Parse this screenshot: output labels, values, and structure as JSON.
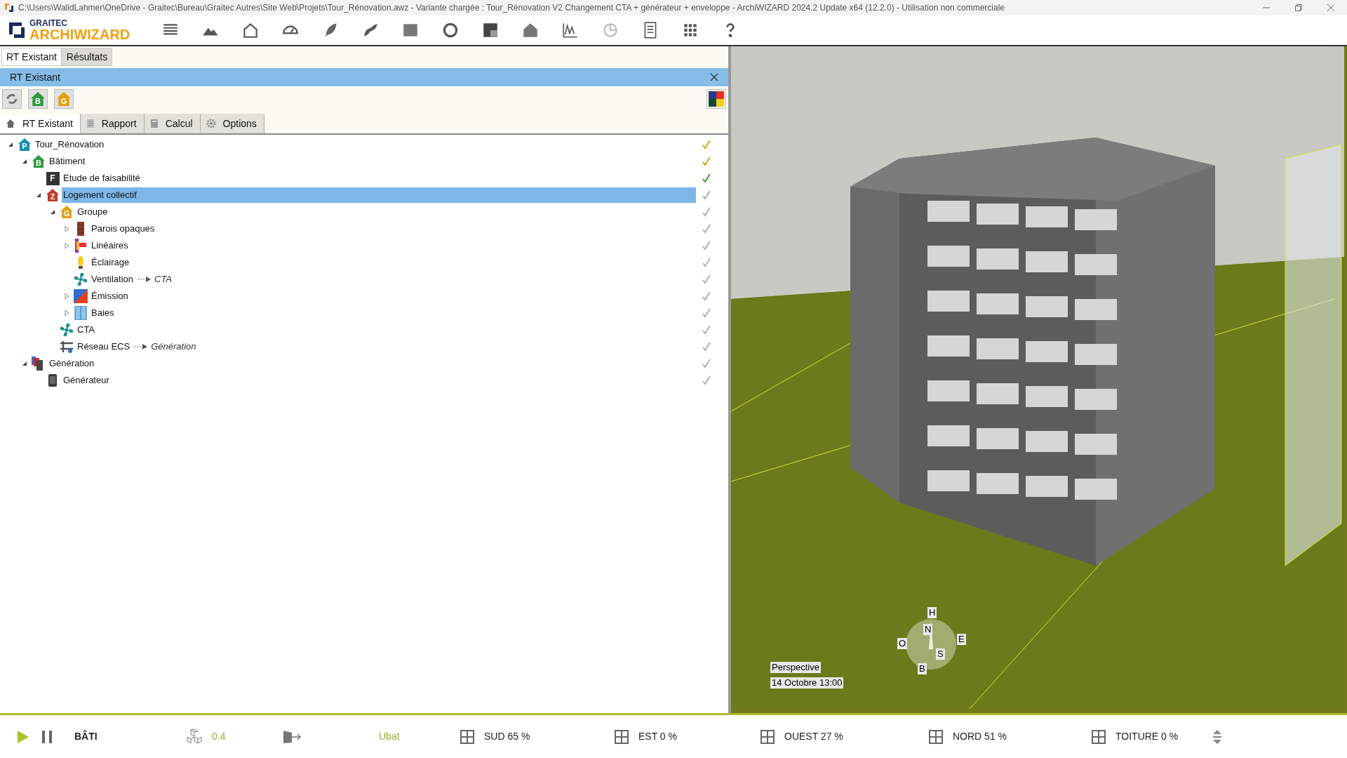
{
  "window": {
    "title": "C:\\Users\\WalidLahmer\\OneDrive - Graitec\\Bureau\\Graitec Autres\\Site Web\\Projets\\Tour_Rénovation.awz - Variante chargée : Tour_Rénovation V2 Changement CTA + générateur + enveloppe  -  ArchiWIZARD 2024.2 Update x64 (12.2.0) - Utilisation non commerciale"
  },
  "logo": {
    "brand": "GRAITEC",
    "product": "ARCHIWIZARD"
  },
  "main_tabs": [
    {
      "label": "RT Existant",
      "selected": true
    },
    {
      "label": "Résultats",
      "selected": false
    }
  ],
  "panel": {
    "title": "RT Existant",
    "tools": [
      {
        "kind": "refresh"
      },
      {
        "kind": "building",
        "badge": "B"
      },
      {
        "kind": "group",
        "badge": "G"
      }
    ],
    "sub_tabs": [
      {
        "label": "RT Existant",
        "selected": true
      },
      {
        "label": "Rapport",
        "selected": false
      },
      {
        "label": "Calcul",
        "selected": false
      },
      {
        "label": "Options",
        "selected": false
      }
    ],
    "tree": [
      {
        "label": "Tour_Rénovation",
        "kind": "project",
        "badge": "P",
        "expanded": true,
        "selected": false,
        "color": "#e0a010",
        "children": [
          {
            "label": "Bâtiment",
            "kind": "building",
            "badge": "B",
            "expanded": true,
            "selected": false,
            "color": "#e0a010",
            "children": [
              {
                "label": "Etude de faisabilité",
                "kind": "study",
                "badge": "F",
                "selected": false,
                "color": "#3aa02a"
              },
              {
                "label": "Logement collectif",
                "kind": "zone",
                "badge": "Z",
                "expanded": true,
                "selected": true,
                "color": "#b0b0b0",
                "children": [
                  {
                    "label": "Groupe",
                    "kind": "group",
                    "badge": "G",
                    "expanded": true,
                    "selected": false,
                    "color": "#b0b0b0",
                    "children": [
                      {
                        "label": "Parois opaques",
                        "kind": "wall",
                        "expanded": false,
                        "selected": false,
                        "color": "#b0b0b0"
                      },
                      {
                        "label": "Linéaires",
                        "kind": "linear",
                        "expanded": false,
                        "selected": false,
                        "color": "#b0b0b0"
                      },
                      {
                        "label": "Éclairage",
                        "kind": "bulb",
                        "selected": false,
                        "color": "#b0b0b0"
                      },
                      {
                        "label": "Ventilation",
                        "kind": "fan",
                        "link": "CTA",
                        "selected": false,
                        "color": "#b0b0b0"
                      },
                      {
                        "label": "Émission",
                        "kind": "emission",
                        "expanded": false,
                        "selected": false,
                        "color": "#b0b0b0"
                      },
                      {
                        "label": "Baies",
                        "kind": "window",
                        "expanded": false,
                        "selected": false,
                        "color": "#b0b0b0"
                      }
                    ]
                  },
                  {
                    "label": "CTA",
                    "kind": "fan",
                    "selected": false,
                    "color": "#b0b0b0"
                  },
                  {
                    "label": "Réseau ECS",
                    "kind": "network",
                    "link": "Génération",
                    "selected": false,
                    "color": "#b0b0b0"
                  }
                ]
              }
            ]
          },
          {
            "label": "Génération",
            "kind": "generation",
            "expanded": true,
            "selected": false,
            "color": "#b0b0b0",
            "children": [
              {
                "label": "Générateur",
                "kind": "generator",
                "selected": false,
                "color": "#b0b0b0"
              }
            ]
          }
        ]
      }
    ]
  },
  "viewport": {
    "compass": {
      "top": "H",
      "north": "N",
      "east": "E",
      "west": "O",
      "south": "S",
      "bottom": "B"
    },
    "view": "Perspective",
    "date": "14 Octobre 13:00"
  },
  "status_bar": {
    "mode": "BÂTI",
    "value": "0.4",
    "indicator": "Ubat",
    "orientations": [
      "SUD 65 %",
      "EST 0 %",
      "OUEST 27 %",
      "NORD 51 %",
      "TOITURE 0 %"
    ]
  }
}
